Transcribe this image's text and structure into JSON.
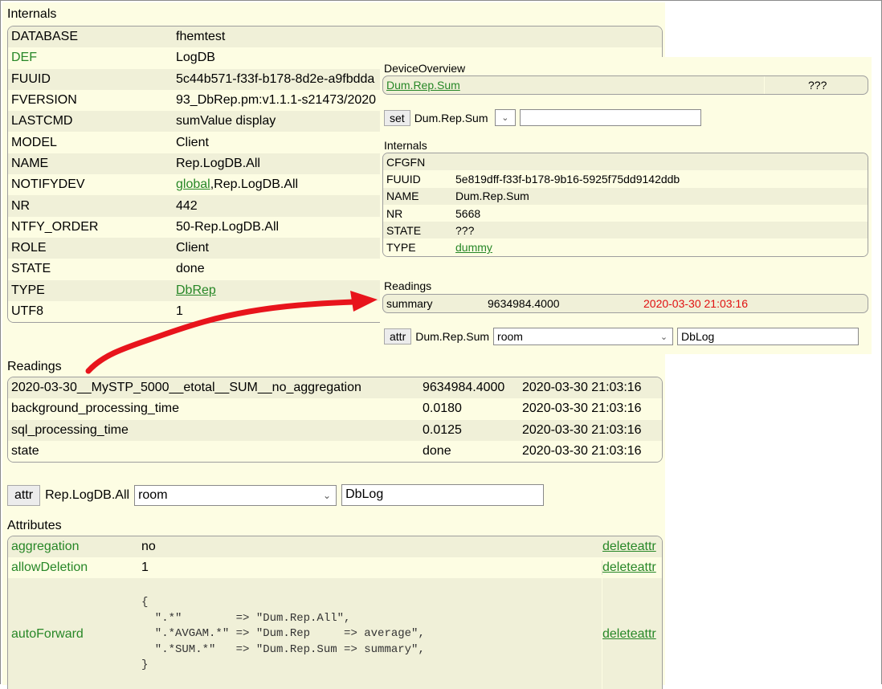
{
  "internals": {
    "title": "Internals",
    "rows": [
      {
        "key": "DATABASE",
        "value": "fhemtest"
      },
      {
        "key": "DEF",
        "value": "LogDB"
      },
      {
        "key": "FUUID",
        "value": "5c44b571-f33f-b178-8d2e-a9fbdda"
      },
      {
        "key": "FVERSION",
        "value": "93_DbRep.pm:v1.1.1-s21473/2020"
      },
      {
        "key": "LASTCMD",
        "value": "sumValue display"
      },
      {
        "key": "MODEL",
        "value": "Client"
      },
      {
        "key": "NAME",
        "value": "Rep.LogDB.All"
      },
      {
        "key": "NOTIFYDEV",
        "value_link": "global",
        "value_rest": ",Rep.LogDB.All"
      },
      {
        "key": "NR",
        "value": "442"
      },
      {
        "key": "NTFY_ORDER",
        "value": "50-Rep.LogDB.All"
      },
      {
        "key": "ROLE",
        "value": "Client"
      },
      {
        "key": "STATE",
        "value": "done"
      },
      {
        "key": "TYPE",
        "value": "DbRep"
      },
      {
        "key": "UTF8",
        "value": "1"
      }
    ]
  },
  "readings": {
    "title": "Readings",
    "rows": [
      {
        "name": "2020-03-30__MySTP_5000__etotal__SUM__no_aggregation",
        "value": "9634984.4000",
        "time": "2020-03-30 21:03:16"
      },
      {
        "name": "background_processing_time",
        "value": "0.0180",
        "time": "2020-03-30 21:03:16"
      },
      {
        "name": "sql_processing_time",
        "value": "0.0125",
        "time": "2020-03-30 21:03:16"
      },
      {
        "name": "state",
        "value": "done",
        "time": "2020-03-30 21:03:16"
      }
    ]
  },
  "attr_bar": {
    "button": "attr",
    "device": "Rep.LogDB.All",
    "select": "room",
    "input": "DbLog"
  },
  "attributes": {
    "title": "Attributes",
    "rows": [
      {
        "name": "aggregation",
        "value": "no",
        "action": "deleteattr"
      },
      {
        "name": "allowDeletion",
        "value": "1",
        "action": "deleteattr"
      },
      {
        "name": "autoForward",
        "code": "{\n  \".*\"        => \"Dum.Rep.All\",\n  \".*AVGAM.*\" => \"Dum.Rep     => average\",\n  \".*SUM.*\"   => \"Dum.Rep.Sum => summary\",\n}",
        "action": "deleteattr"
      }
    ]
  },
  "overlay": {
    "overview_title": "DeviceOverview",
    "overview_device": "Dum.Rep.Sum",
    "overview_state": "???",
    "set_button": "set",
    "set_device": "Dum.Rep.Sum",
    "internals_title": "Internals",
    "internals": [
      {
        "key": "CFGFN",
        "value": ""
      },
      {
        "key": "FUUID",
        "value": "5e819dff-f33f-b178-9b16-5925f75dd9142ddb"
      },
      {
        "key": "NAME",
        "value": "Dum.Rep.Sum"
      },
      {
        "key": "NR",
        "value": "5668"
      },
      {
        "key": "STATE",
        "value": "???"
      },
      {
        "key": "TYPE",
        "value": "dummy"
      }
    ],
    "readings_title": "Readings",
    "reading": {
      "name": "summary",
      "value": "9634984.4000",
      "time": "2020-03-30 21:03:16"
    },
    "attr_button": "attr",
    "attr_device": "Dum.Rep.Sum",
    "attr_select": "room",
    "attr_input": "DbLog"
  },
  "colors": {
    "background": "#fdfde3",
    "stripe": "#f0f0d8",
    "link": "#278727",
    "annotation_arrow": "#e8141c",
    "timestamp_red": "#e01010"
  }
}
